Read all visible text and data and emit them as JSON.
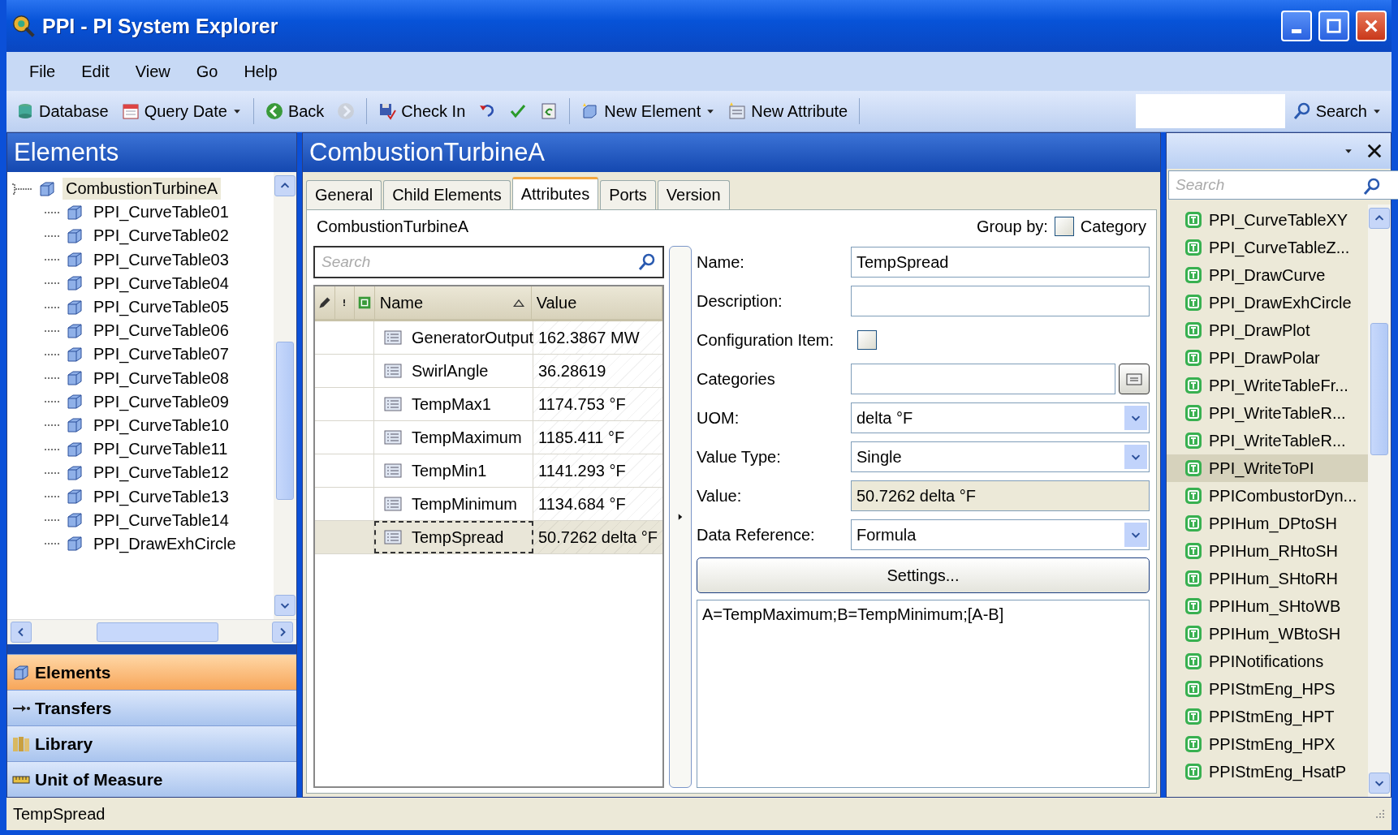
{
  "window": {
    "title": "PPI - PI System Explorer"
  },
  "menu": [
    "File",
    "Edit",
    "View",
    "Go",
    "Help"
  ],
  "toolbar": [
    {
      "kind": "button",
      "label": "Database",
      "dropdown": false
    },
    {
      "kind": "button",
      "label": "Query Date",
      "dropdown": true
    },
    {
      "kind": "separator"
    },
    {
      "kind": "button",
      "label": "Back",
      "dropdown": false
    },
    {
      "kind": "icon",
      "disabled": true
    },
    {
      "kind": "separator"
    },
    {
      "kind": "button",
      "label": "Check In",
      "dropdown": false
    },
    {
      "kind": "icon",
      "disabled": false
    },
    {
      "kind": "icon",
      "disabled": false
    },
    {
      "kind": "icon",
      "disabled": false
    },
    {
      "kind": "separator"
    },
    {
      "kind": "button",
      "label": "New Element",
      "dropdown": true
    },
    {
      "kind": "button",
      "label": "New Attribute",
      "dropdown": false
    },
    {
      "kind": "separator"
    }
  ],
  "toolbar_search": {
    "label": "Search"
  },
  "left_panel": {
    "title": "Elements",
    "tree": [
      {
        "label": "CombustionTurbineA",
        "selected": true,
        "expanded": true,
        "children": [
          {
            "label": "PPI_CurveTable01",
            "selected": false
          },
          {
            "label": "PPI_CurveTable02",
            "selected": false
          },
          {
            "label": "PPI_CurveTable03",
            "selected": false
          },
          {
            "label": "PPI_CurveTable04",
            "selected": false
          },
          {
            "label": "PPI_CurveTable05",
            "selected": false
          },
          {
            "label": "PPI_CurveTable06",
            "selected": false
          },
          {
            "label": "PPI_CurveTable07",
            "selected": false
          },
          {
            "label": "PPI_CurveTable08",
            "selected": false
          },
          {
            "label": "PPI_CurveTable09",
            "selected": false
          },
          {
            "label": "PPI_CurveTable10",
            "selected": false
          },
          {
            "label": "PPI_CurveTable11",
            "selected": false
          },
          {
            "label": "PPI_CurveTable12",
            "selected": false
          },
          {
            "label": "PPI_CurveTable13",
            "selected": false
          },
          {
            "label": "PPI_CurveTable14",
            "selected": false
          },
          {
            "label": "PPI_DrawExhCircle",
            "selected": false
          }
        ]
      }
    ],
    "nav": [
      {
        "label": "Elements",
        "selected": true
      },
      {
        "label": "Transfers",
        "selected": false
      },
      {
        "label": "Library",
        "selected": false
      },
      {
        "label": "Unit of Measure",
        "selected": false
      }
    ]
  },
  "center": {
    "title": "CombustionTurbineA",
    "tabs": [
      {
        "label": "General",
        "selected": false
      },
      {
        "label": "Child Elements",
        "selected": false
      },
      {
        "label": "Attributes",
        "selected": true
      },
      {
        "label": "Ports",
        "selected": false
      },
      {
        "label": "Version",
        "selected": false
      }
    ],
    "path": "CombustionTurbineA",
    "group_by": {
      "label": "Group by:",
      "option": "Category",
      "checked": false
    },
    "search": {
      "placeholder": "Search"
    },
    "columns": [
      {
        "label": "Name",
        "sorted": true
      },
      {
        "label": "Value",
        "sorted": false
      }
    ],
    "rows": [
      {
        "name": "GeneratorOutput",
        "value": "162.3867 MW",
        "selected": false
      },
      {
        "name": "SwirlAngle",
        "value": "36.28619",
        "selected": false
      },
      {
        "name": "TempMax1",
        "value": "1174.753 °F",
        "selected": false
      },
      {
        "name": "TempMaximum",
        "value": "1185.411 °F",
        "selected": false
      },
      {
        "name": "TempMin1",
        "value": "1141.293 °F",
        "selected": false
      },
      {
        "name": "TempMinimum",
        "value": "1134.684 °F",
        "selected": false
      },
      {
        "name": "TempSpread",
        "value": "50.7262 delta °F",
        "selected": true
      }
    ],
    "fields": [
      {
        "kind": "text",
        "label": "Name:",
        "value": "TempSpread"
      },
      {
        "kind": "text",
        "label": "Description:"
      },
      {
        "kind": "checkbox",
        "label": "Configuration Item:",
        "checked": false
      },
      {
        "kind": "browse",
        "label": "Categories"
      },
      {
        "kind": "dropdown",
        "label": "UOM:",
        "value": "delta °F"
      },
      {
        "kind": "dropdown",
        "label": "Value Type:",
        "value": "Single"
      },
      {
        "kind": "readonly",
        "label": "Value:",
        "value": "50.7262 delta °F"
      },
      {
        "kind": "dropdown",
        "label": "Data Reference:",
        "value": "Formula"
      }
    ],
    "settings_button": "Settings...",
    "config_text": "A=TempMaximum;B=TempMinimum;[A-B]"
  },
  "right_panel": {
    "search": {
      "placeholder": "Search"
    },
    "items": [
      {
        "label": "PPI_CurveTableXY",
        "selected": false
      },
      {
        "label": "PPI_CurveTableZ...",
        "selected": false
      },
      {
        "label": "PPI_DrawCurve",
        "selected": false
      },
      {
        "label": "PPI_DrawExhCircle",
        "selected": false
      },
      {
        "label": "PPI_DrawPlot",
        "selected": false
      },
      {
        "label": "PPI_DrawPolar",
        "selected": false
      },
      {
        "label": "PPI_WriteTableFr...",
        "selected": false
      },
      {
        "label": "PPI_WriteTableR...",
        "selected": false
      },
      {
        "label": "PPI_WriteTableR...",
        "selected": false
      },
      {
        "label": "PPI_WriteToPI",
        "selected": true
      },
      {
        "label": "PPICombustorDyn...",
        "selected": false
      },
      {
        "label": "PPIHum_DPtoSH",
        "selected": false
      },
      {
        "label": "PPIHum_RHtoSH",
        "selected": false
      },
      {
        "label": "PPIHum_SHtoRH",
        "selected": false
      },
      {
        "label": "PPIHum_SHtoWB",
        "selected": false
      },
      {
        "label": "PPIHum_WBtoSH",
        "selected": false
      },
      {
        "label": "PPINotifications",
        "selected": false
      },
      {
        "label": "PPIStmEng_HPS",
        "selected": false
      },
      {
        "label": "PPIStmEng_HPT",
        "selected": false
      },
      {
        "label": "PPIStmEng_HPX",
        "selected": false
      },
      {
        "label": "PPIStmEng_HsatP",
        "selected": false
      }
    ]
  },
  "status_bar": {
    "text": "TempSpread"
  }
}
